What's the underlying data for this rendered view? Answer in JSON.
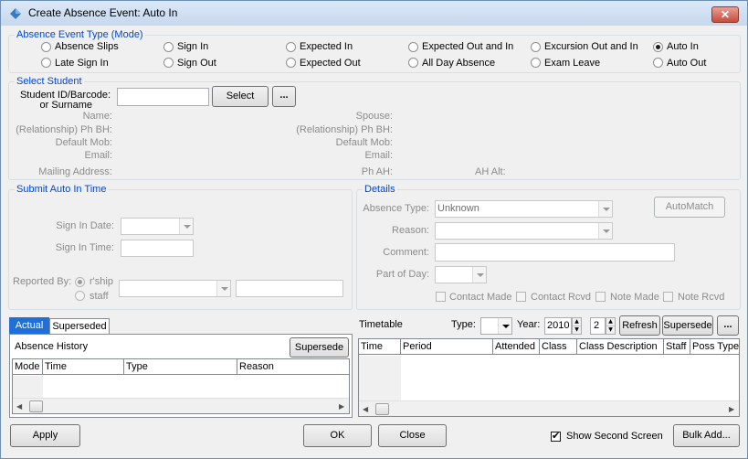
{
  "window": {
    "title": "Create Absence Event: Auto In",
    "close_glyph": "✕"
  },
  "event_type": {
    "title": "Absence Event Type (Mode)",
    "options": [
      {
        "label": "Absence Slips",
        "selected": false
      },
      {
        "label": "Late Sign In",
        "selected": false
      },
      {
        "label": "Sign In",
        "selected": false
      },
      {
        "label": "Sign Out",
        "selected": false
      },
      {
        "label": "Expected In",
        "selected": false
      },
      {
        "label": "Expected Out",
        "selected": false
      },
      {
        "label": "Expected Out and In",
        "selected": false
      },
      {
        "label": "All Day Absence",
        "selected": false
      },
      {
        "label": "Excursion Out and In",
        "selected": false
      },
      {
        "label": "Exam Leave",
        "selected": false
      },
      {
        "label": "Auto In",
        "selected": true
      },
      {
        "label": "Auto Out",
        "selected": false
      }
    ]
  },
  "select_student": {
    "title": "Select Student",
    "id_label_1": "Student ID/Barcode:",
    "id_label_2": "or Surname",
    "id_value": "",
    "select_button": "Select",
    "more_button": "...",
    "name_label": "Name:",
    "ph_bh_label": "(Relationship) Ph BH:",
    "default_mob_label": "Default Mob:",
    "email_label": "Email:",
    "mailing_label": "Mailing Address:",
    "spouse_label": "Spouse:",
    "spouse_ph_bh_label": "(Relationship) Ph BH:",
    "spouse_mob_label": "Default Mob:",
    "spouse_email_label": "Email:",
    "ph_ah_label": "Ph AH:",
    "ah_alt_label": "AH Alt:"
  },
  "submit": {
    "title": "Submit Auto In Time",
    "sign_in_date_label": "Sign In Date:",
    "sign_in_date_value": "",
    "sign_in_time_label": "Sign In Time:",
    "sign_in_time_value": "",
    "reported_by_label": "Reported By:",
    "rship_label": "r'ship",
    "staff_label": "staff",
    "reported_value": "",
    "reported_text": ""
  },
  "details": {
    "title": "Details",
    "absence_type_label": "Absence Type:",
    "absence_type_value": "Unknown",
    "reason_label": "Reason:",
    "reason_value": "",
    "comment_label": "Comment:",
    "comment_value": "",
    "part_of_day_label": "Part of Day:",
    "part_of_day_value": "",
    "automatch_button": "AutoMatch",
    "checks": [
      {
        "label": "Contact Made",
        "checked": false
      },
      {
        "label": "Contact Rcvd",
        "checked": false
      },
      {
        "label": "Note Made",
        "checked": false
      },
      {
        "label": "Note Rcvd",
        "checked": false
      }
    ]
  },
  "history": {
    "tabs": [
      {
        "label": "Actual",
        "active": true
      },
      {
        "label": "Superseded",
        "active": false
      }
    ],
    "title": "Absence History",
    "supersede_button": "Supersede",
    "columns": [
      "Mode",
      "Time",
      "Type",
      "Reason"
    ],
    "rows": []
  },
  "timetable": {
    "title": "Timetable",
    "type_label": "Type:",
    "type_value": "",
    "year_label": "Year:",
    "year_value": "2010",
    "term_value": "2",
    "refresh_button": "Refresh",
    "supersede_button": "Supersede",
    "more_button": "...",
    "columns": [
      "Time",
      "Period",
      "Attended",
      "Class",
      "Class Description",
      "Staff",
      "Poss Type"
    ],
    "rows": []
  },
  "footer": {
    "apply_button": "Apply",
    "ok_button": "OK",
    "close_button": "Close",
    "show_second_screen_label": "Show Second Screen",
    "show_second_screen_checked": true,
    "bulk_add_button": "Bulk Add..."
  },
  "colors": {
    "accent": "#0046d5",
    "tab_active": "#1e6fd6",
    "close_button": "#c74b3a"
  }
}
